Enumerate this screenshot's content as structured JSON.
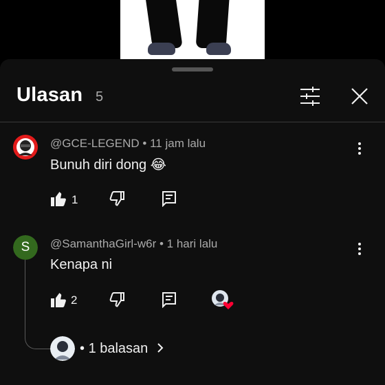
{
  "sheet": {
    "title": "Ulasan",
    "count": "5"
  },
  "icons": {
    "filter": "sliders-icon",
    "close": "close-icon",
    "like": "thumbs-up-icon",
    "dislike": "thumbs-down-icon",
    "reply": "comment-icon",
    "more": "more-vert-icon",
    "creator_heart": "heart-icon",
    "chevron": "chevron-right-icon"
  },
  "comments": [
    {
      "author": "@GCE-LEGEND",
      "time": "11 jam lalu",
      "text": "Bunuh diri dong 😂",
      "likes": "1"
    },
    {
      "author": "@SamanthaGirl-w6r",
      "avatar_letter": "S",
      "avatar_color": "#33691e",
      "time": "1 hari lalu",
      "text": "Kenapa ni",
      "likes": "2",
      "replies": "1 balasan"
    }
  ],
  "colors": {
    "background": "#0f0f0f",
    "text": "#f1f1f1",
    "secondary_text": "#aaaaaa",
    "heart": "#ff0033"
  }
}
